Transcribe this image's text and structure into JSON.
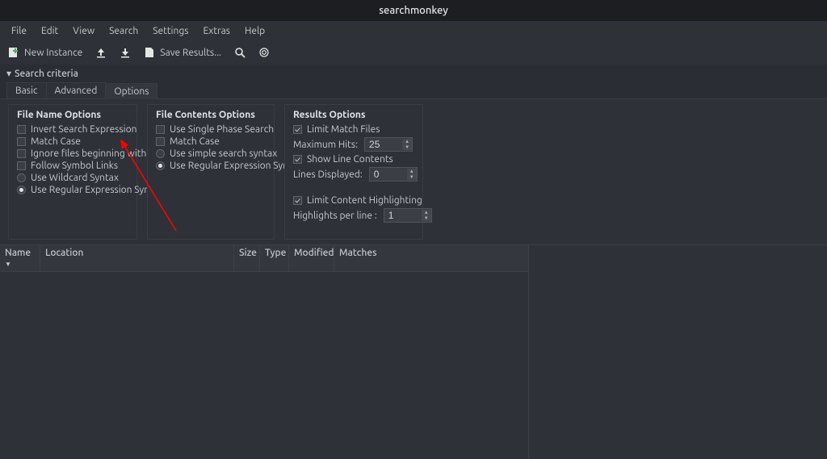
{
  "window": {
    "title": "searchmonkey"
  },
  "menubar": [
    "File",
    "Edit",
    "View",
    "Search",
    "Settings",
    "Extras",
    "Help"
  ],
  "toolbar": {
    "new_instance": "New Instance",
    "save_results": "Save Results..."
  },
  "criteria": {
    "label": "Search criteria",
    "tabs": [
      "Basic",
      "Advanced",
      "Options"
    ],
    "active_tab": "Options"
  },
  "file_name_options": {
    "title": "File Name Options",
    "invert": "Invert Search Expression",
    "match_case": "Match Case",
    "ignore_dot": "Ignore files beginning with '.'",
    "follow_symlinks": "Follow Symbol Links",
    "wildcard": "Use Wildcard Syntax",
    "regex": "Use Regular Expression Syntax"
  },
  "file_contents_options": {
    "title": "File Contents Options",
    "single_phase": "Use Single Phase Search",
    "match_case": "Match Case",
    "simple": "Use simple search syntax",
    "regex": "Use Regular Expression Syntax"
  },
  "results_options": {
    "title": "Results Options",
    "limit_match": "Limit Match Files",
    "max_hits_label": "Maximum Hits:",
    "max_hits_value": "25",
    "show_line": "Show Line Contents",
    "lines_displayed_label": "Lines Displayed:",
    "lines_displayed_value": "0",
    "limit_highlight": "Limit Content Highlighting",
    "highlights_label": "Highlights per line :",
    "highlights_value": "1"
  },
  "table": {
    "headers": {
      "name": "Name",
      "location": "Location",
      "size": "Size",
      "type": "Type",
      "modified": "Modified",
      "matches": "Matches"
    }
  }
}
